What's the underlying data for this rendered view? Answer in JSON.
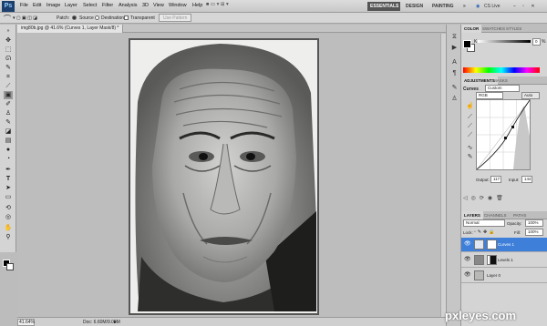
{
  "app": {
    "logo": "Ps"
  },
  "menu": [
    "File",
    "Edit",
    "Image",
    "Layer",
    "Select",
    "Filter",
    "Analysis",
    "3D",
    "View",
    "Window",
    "Help"
  ],
  "workspaces": {
    "essentials": "ESSENTIALS",
    "design": "DESIGN",
    "painting": "PAINTING",
    "more": "»",
    "cs_live": "CS Live"
  },
  "options": {
    "patch_label": "Patch:",
    "source": "Source",
    "destination": "Destination",
    "transparent": "Transparent",
    "use_pattern": "Use Pattern"
  },
  "document": {
    "tab_title": "img80b.jpg @ 41.6% (Curves 1, Layer Mask/8) *",
    "zoom": "41.64%",
    "info": "Doc: 6.60M/9.02M"
  },
  "color_panel": {
    "tabs": [
      "COLOR",
      "SWATCHES",
      "STYLES"
    ],
    "channel": "K",
    "value": "0",
    "unit": "%"
  },
  "adjustments": {
    "tabs": [
      "ADJUSTMENTS",
      "MASKS"
    ],
    "title": "Curves",
    "preset": "Custom",
    "channel": "RGB",
    "auto": "Auto",
    "output_label": "Output:",
    "output_value": "117",
    "input_label": "Input:",
    "input_value": "144"
  },
  "layers_panel": {
    "tabs": [
      "LAYERS",
      "CHANNELS",
      "PATHS"
    ],
    "blend_mode": "Normal",
    "opacity_label": "Opacity:",
    "opacity": "100%",
    "lock_label": "Lock:",
    "fill_label": "Fill:",
    "fill": "100%",
    "layers": [
      {
        "name": "Curves 1"
      },
      {
        "name": "Levels 1"
      },
      {
        "name": "Layer 0"
      }
    ]
  },
  "watermark": "pxleyes.com"
}
